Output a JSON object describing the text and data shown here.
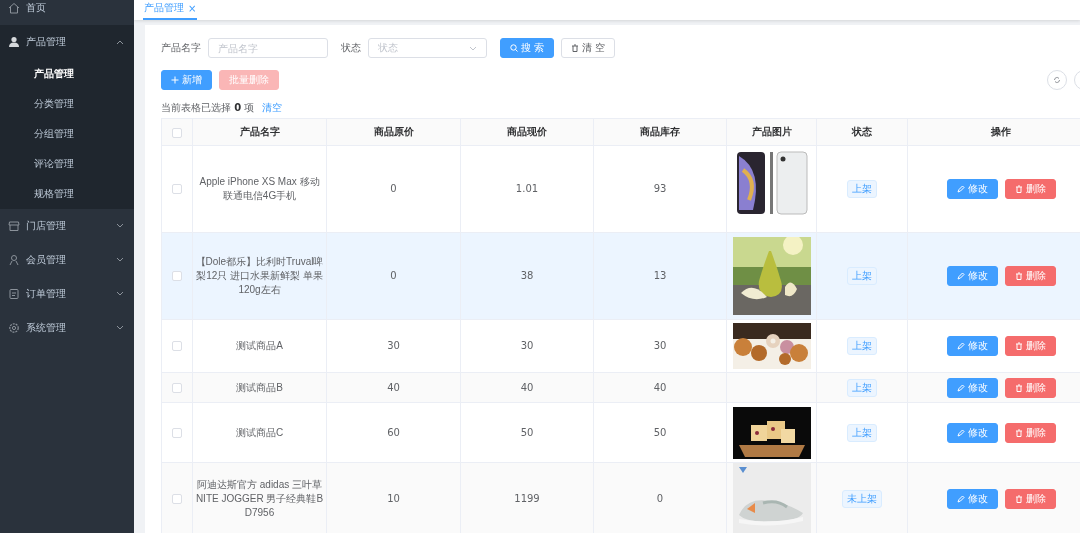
{
  "sidebar": {
    "items": [
      {
        "label": "首页",
        "expanded": false,
        "selected": false
      },
      {
        "label": "产品管理",
        "expanded": true,
        "selected": false,
        "children": [
          {
            "label": "产品管理",
            "selected": true
          },
          {
            "label": "分类管理",
            "selected": false
          },
          {
            "label": "分组管理",
            "selected": false
          },
          {
            "label": "评论管理",
            "selected": false
          },
          {
            "label": "规格管理",
            "selected": false
          }
        ]
      },
      {
        "label": "门店管理",
        "expanded": false,
        "selected": false
      },
      {
        "label": "会员管理",
        "expanded": false,
        "selected": false
      },
      {
        "label": "订单管理",
        "expanded": false,
        "selected": false
      },
      {
        "label": "系统管理",
        "expanded": false,
        "selected": false
      }
    ]
  },
  "tabs": [
    {
      "label": "产品管理",
      "close": "×",
      "selected": true
    }
  ],
  "search": {
    "fields": [
      {
        "label": "产品名字",
        "kind": "input",
        "placeholder": "产品名字"
      },
      {
        "label": "状态",
        "kind": "select",
        "placeholder": "状态"
      }
    ],
    "buttons": [
      {
        "label": "搜 索",
        "kind": "search"
      },
      {
        "label": "清 空",
        "kind": "clear"
      }
    ]
  },
  "actions": [
    {
      "label": "新增",
      "kind": "add",
      "disabled": false
    },
    {
      "label": "批量删除",
      "kind": "batch-delete",
      "disabled": true
    }
  ],
  "selection": {
    "prefix": "当前表格已选择",
    "count": "0",
    "suffix": "项",
    "clear": "清空"
  },
  "table": {
    "header_checked": false,
    "columns": [
      "产品名字",
      "商品原价",
      "商品现价",
      "商品库存",
      "产品图片",
      "状态",
      "操作"
    ],
    "rows": [
      {
        "checked": false,
        "highlighted": false,
        "name": "Apple iPhone XS Max 移动联通电信4G手机",
        "original_price": "0",
        "price": "1.01",
        "stock": "93",
        "status": "上架",
        "edit": "修改",
        "delete": "删除"
      },
      {
        "checked": false,
        "highlighted": true,
        "name": "【Dole都乐】比利时Truval啤梨12只 进口水果新鲜梨 单果120g左右",
        "original_price": "0",
        "price": "38",
        "stock": "13",
        "status": "上架",
        "edit": "修改",
        "delete": "删除"
      },
      {
        "checked": false,
        "highlighted": false,
        "name": "测试商品A",
        "original_price": "30",
        "price": "30",
        "stock": "30",
        "status": "上架",
        "edit": "修改",
        "delete": "删除"
      },
      {
        "checked": false,
        "highlighted": false,
        "name": "测试商品B",
        "original_price": "40",
        "price": "40",
        "stock": "40",
        "status": "上架",
        "edit": "修改",
        "delete": "删除"
      },
      {
        "checked": false,
        "highlighted": false,
        "name": "测试商品C",
        "original_price": "60",
        "price": "50",
        "stock": "50",
        "status": "上架",
        "edit": "修改",
        "delete": "删除"
      },
      {
        "checked": false,
        "highlighted": false,
        "name": "阿迪达斯官方 adidas 三叶草 NITE JOGGER 男子经典鞋BD7956",
        "original_price": "10",
        "price": "1199",
        "stock": "0",
        "status": "未上架",
        "edit": "修改",
        "delete": "删除"
      }
    ]
  }
}
